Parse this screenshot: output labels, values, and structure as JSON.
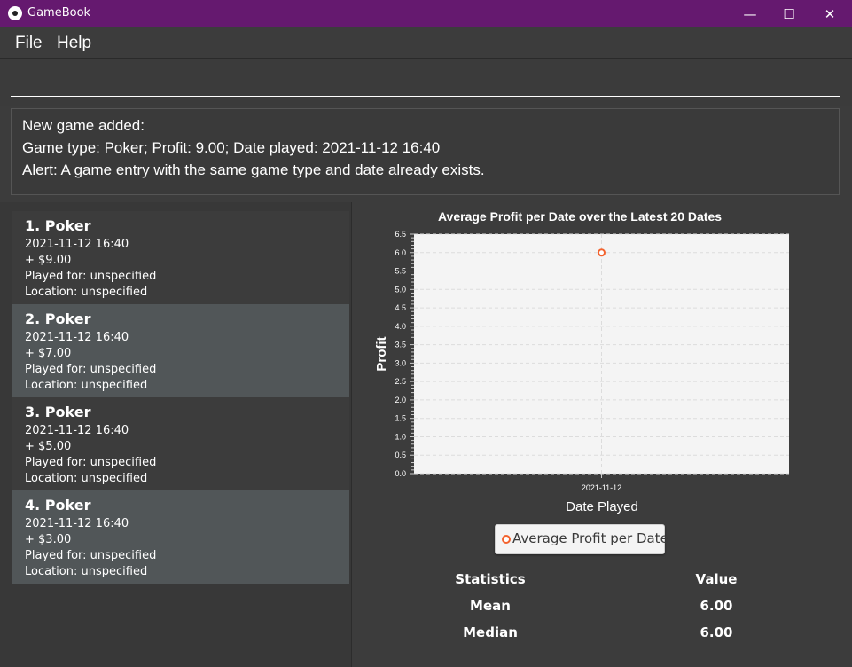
{
  "window": {
    "title": "GameBook",
    "minimize": "—",
    "maximize": "☐",
    "close": "✕"
  },
  "menu": {
    "file": "File",
    "help": "Help"
  },
  "command": {
    "value": "",
    "placeholder": ""
  },
  "result": {
    "line1": "New game added:",
    "line2": "Game type: Poker; Profit: 9.00; Date played: 2021-11-12 16:40",
    "line3": "Alert: A game entry with the same game type and date already exists."
  },
  "games": [
    {
      "title": "1.  Poker",
      "date": "2021-11-12 16:40",
      "profit": "+ $9.00",
      "played_for": "Played for: unspecified",
      "location": "Location: unspecified"
    },
    {
      "title": "2.  Poker",
      "date": "2021-11-12 16:40",
      "profit": "+ $7.00",
      "played_for": "Played for: unspecified",
      "location": "Location: unspecified"
    },
    {
      "title": "3.  Poker",
      "date": "2021-11-12 16:40",
      "profit": "+ $5.00",
      "played_for": "Played for: unspecified",
      "location": "Location: unspecified"
    },
    {
      "title": "4.  Poker",
      "date": "2021-11-12 16:40",
      "profit": "+ $3.00",
      "played_for": "Played for: unspecified",
      "location": "Location: unspecified"
    }
  ],
  "chart_data": {
    "type": "line",
    "title": "Average Profit per Date over the Latest 20 Dates",
    "xlabel": "Date Played",
    "ylabel": "Profit",
    "categories": [
      "2021-11-12"
    ],
    "series": [
      {
        "name": "Average Profit per Date",
        "values": [
          6.0
        ]
      }
    ],
    "ylim": [
      0,
      6.5
    ],
    "yticks": [
      "0.0",
      "0.5",
      "1.0",
      "1.5",
      "2.0",
      "2.5",
      "3.0",
      "3.5",
      "4.0",
      "4.5",
      "5.0",
      "5.5",
      "6.0",
      "6.5"
    ],
    "grid": true,
    "legend": "bottom",
    "marker_color": "#f3622d"
  },
  "stats": {
    "header_stat": "Statistics",
    "header_value": "Value",
    "rows": [
      {
        "label": "Mean",
        "value": "6.00"
      },
      {
        "label": "Median",
        "value": "6.00"
      }
    ]
  }
}
